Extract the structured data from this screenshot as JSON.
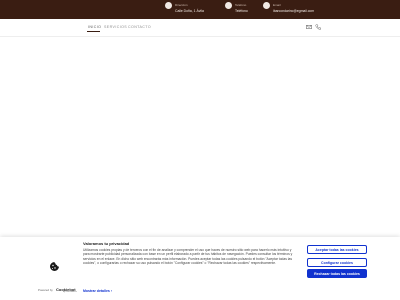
{
  "contact": [
    {
      "label": "Dirección",
      "value": "Calle Doña, 1 Ávila",
      "icon": "location-icon"
    },
    {
      "label": "Teléfono",
      "value": "Teléfono",
      "icon": "phone-icon"
    },
    {
      "label": "Email",
      "value": "ibarcondarinc@egmail.com",
      "icon": "email-icon"
    }
  ],
  "nav": {
    "items": [
      "INICIO",
      "SERVICIOS",
      "CONTACTO"
    ],
    "active": "INICIO"
  },
  "cookie": {
    "title": "Valoramos tu privacidad",
    "text": "Utilizamos cookies propias y de terceros con el fin de analizar y comprender el uso que haces de nuestro sitio web para hacerlo más intuitivo y para mostrarte publicidad personalizada con base en un perfil elaborado a partir de tus hábitos de navegación. Puedes consultar los términos y servicios en el enlace. En dicho sitio web encontrarás más información. Puedes aceptar todas las cookies pulsando el botón \"Aceptar todas las cookies\", o configurarlas o rechazar su uso pulsando el botón \"Configurar cookies\" o \"Rechazar todas las cookies\" respectivamente.",
    "more_label": "Mostrar detalles",
    "powered_label": "Powered by",
    "brand": "Cookiebot",
    "brand_sub": "by Usercentrics",
    "buttons": {
      "accept_all": "Aceptar todas las cookies",
      "configure": "Configurar cookies",
      "reject_all": "Rechazar todas las cookies"
    },
    "accent_color": "#1032cf"
  },
  "colors": {
    "topbar": "#3a1d12"
  }
}
